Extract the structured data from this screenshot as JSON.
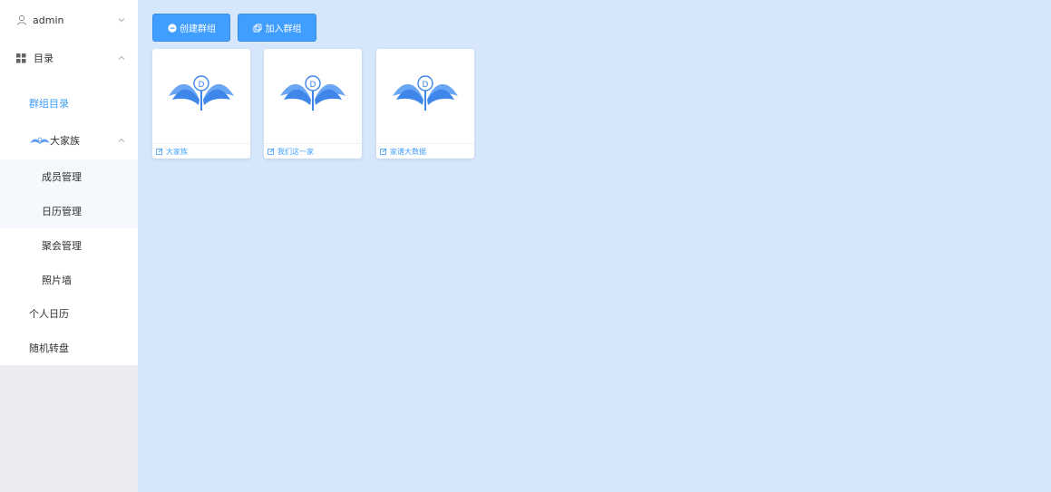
{
  "sidebar": {
    "user": {
      "name": "admin"
    },
    "catalog": {
      "label": "目录"
    },
    "group_catalog": {
      "label": "群组目录"
    },
    "family": {
      "label": "大家族"
    },
    "sub_items": [
      "成员管理",
      "日历管理",
      "聚会管理",
      "照片墙"
    ],
    "personal_calendar": {
      "label": "个人日历"
    },
    "random_wheel": {
      "label": "随机转盘"
    }
  },
  "toolbar": {
    "create_label": "创建群组",
    "join_label": "加入群组"
  },
  "groups": [
    {
      "name": "大家族"
    },
    {
      "name": "我们这一家"
    },
    {
      "name": "家谱大数据"
    }
  ],
  "colors": {
    "accent": "#409eff",
    "main_bg": "#d6e6fb",
    "sidebar_bg": "#ececf0",
    "menu_bg": "#ffffff",
    "active_text": "#409eff"
  },
  "icons": [
    "user-icon",
    "chevron-down-icon",
    "grid-icon",
    "chevron-up-icon",
    "winged-logo-icon",
    "plus-circle-icon",
    "copy-icon",
    "edit-icon"
  ]
}
